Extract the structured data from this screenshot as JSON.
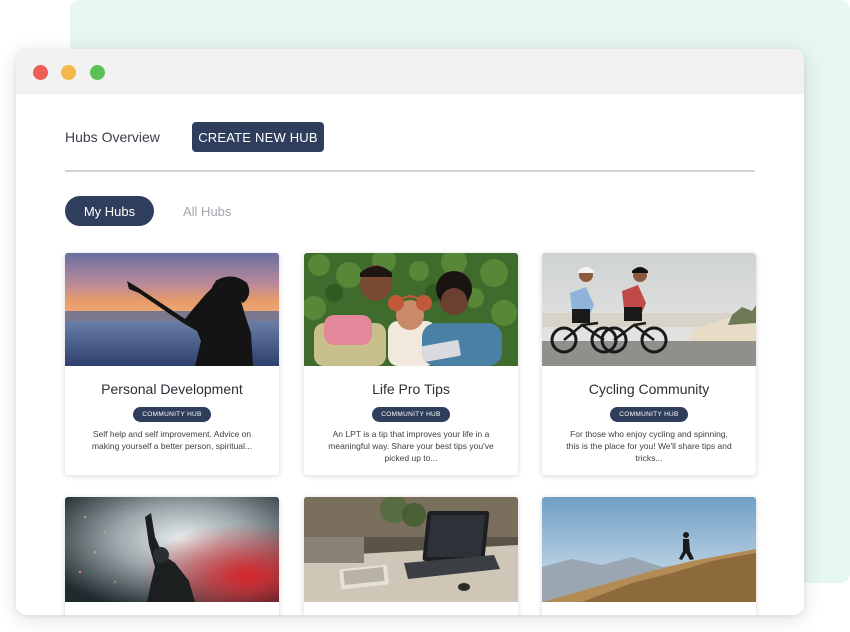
{
  "header": {
    "title": "Hubs Overview",
    "create_button": "CREATE NEW HUB"
  },
  "tabs": {
    "active": "My Hubs",
    "inactive": "All Hubs"
  },
  "cards": [
    {
      "title": "Personal Development",
      "badge": "COMMUNITY HUB",
      "description": "Self help and self improvement. Advice on making yourself a better person, spiritual..."
    },
    {
      "title": "Life Pro Tips",
      "badge": "COMMUNITY HUB",
      "description": "An LPT is a tip that improves your life in a meaningful way. Share your best tips you've picked up to..."
    },
    {
      "title": "Cycling Community",
      "badge": "COMMUNITY HUB",
      "description": "For those who enjoy cycling and spinning, this is the place for you! We'll share tips and tricks..."
    }
  ],
  "colors": {
    "primary": "#2f3e5c",
    "background_panel": "#e6f6f1",
    "window_red": "#ec5f5a",
    "window_yellow": "#f3b94a",
    "window_green": "#5bc156"
  }
}
